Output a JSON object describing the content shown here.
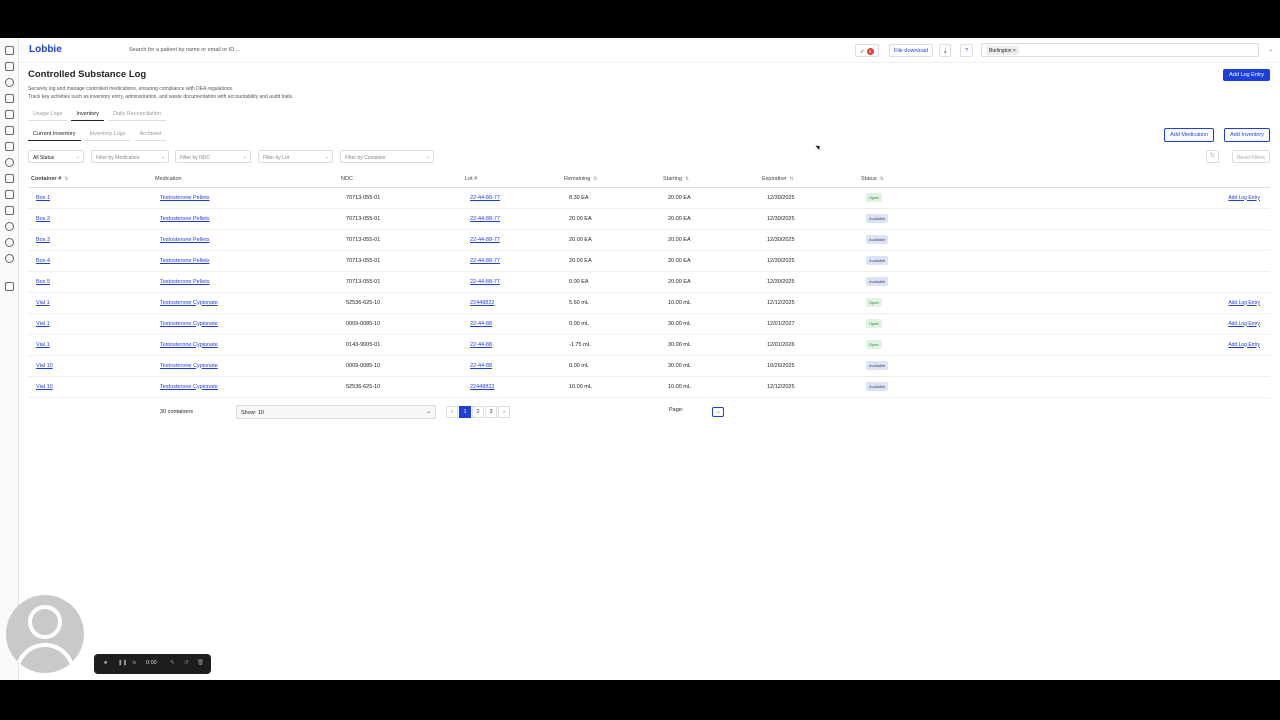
{
  "app": {
    "logo": "Lobbie"
  },
  "topbar": {
    "search_placeholder": "Search for a patient by name or email or ID ...",
    "tasks_count": "6",
    "file_download": "File download",
    "location_chip": "Burlington"
  },
  "page": {
    "title": "Controlled Substance Log",
    "desc_line1": "Securely log and manage controlled medications, ensuring compliance with DEA regulations.",
    "desc_line2": "Track key activities such as inventory entry, administration, and waste documentation with accountability and audit trails.",
    "add_log_entry": "Add Log Entry"
  },
  "tabs": [
    "Usage Logs",
    "Inventory",
    "Daily Reconciliation"
  ],
  "subtabs": [
    "Current Inventory",
    "Inventory Logs",
    "Archived"
  ],
  "buttons": {
    "add_medication": "Add Medication",
    "add_inventory": "Add Inventory",
    "reset_filters": "Reset Filters"
  },
  "filters": {
    "status": "All Status",
    "medication": "Filter by Medication",
    "ndc": "Filter by NDC",
    "lot": "Filter by Lot",
    "container": "Filter by Container"
  },
  "table": {
    "headers": [
      "Container #",
      "Medication",
      "NDC",
      "Lot #",
      "Remaining",
      "Starting",
      "Expiration",
      "Status"
    ],
    "rows": [
      {
        "container": "Box 1",
        "medication": "Testosterone Pellets",
        "ndc": "70713-055-01",
        "lot": "22-44-88-77",
        "remaining": "8.30 EA",
        "starting": "20.00 EA",
        "expiration": "12/30/2025",
        "status": "Open",
        "action": "Add Log Entry"
      },
      {
        "container": "Box 2",
        "medication": "Testosterone Pellets",
        "ndc": "70713-055-01",
        "lot": "22-44-88-77",
        "remaining": "20.00 EA",
        "starting": "20.00 EA",
        "expiration": "12/30/2025",
        "status": "Available",
        "action": ""
      },
      {
        "container": "Box 3",
        "medication": "Testosterone Pellets",
        "ndc": "70713-055-01",
        "lot": "22-44-88-77",
        "remaining": "20.00 EA",
        "starting": "20.00 EA",
        "expiration": "12/30/2025",
        "status": "Available",
        "action": ""
      },
      {
        "container": "Box 4",
        "medication": "Testosterone Pellets",
        "ndc": "70713-055-01",
        "lot": "22-44-88-77",
        "remaining": "20.00 EA",
        "starting": "20.00 EA",
        "expiration": "12/30/2025",
        "status": "Available",
        "action": ""
      },
      {
        "container": "Box 5",
        "medication": "Testosterone Pellets",
        "ndc": "70713-055-01",
        "lot": "22-44-88-77",
        "remaining": "0.00 EA",
        "starting": "20.00 EA",
        "expiration": "12/30/2025",
        "status": "Available",
        "action": ""
      },
      {
        "container": "Vial 1",
        "medication": "Testosterone Cypionate",
        "ndc": "52536-625-10",
        "lot": "22448822",
        "remaining": "5.60 mL",
        "starting": "10.00 mL",
        "expiration": "12/12/2025",
        "status": "Open",
        "action": "Add Log Entry"
      },
      {
        "container": "Vial 1",
        "medication": "Testosterone Cypionate",
        "ndc": "0009-0085-10",
        "lot": "22-44-88",
        "remaining": "0.00 mL",
        "starting": "30.00 mL",
        "expiration": "12/01/2027",
        "status": "Open",
        "action": "Add Log Entry"
      },
      {
        "container": "Vial 1",
        "medication": "Testosterone Cypionate",
        "ndc": "0143-9005-01",
        "lot": "22-44-88",
        "remaining": "-1.75 mL",
        "starting": "30.00 mL",
        "expiration": "12/01/2026",
        "status": "Open",
        "action": "Add Log Entry"
      },
      {
        "container": "Vial 10",
        "medication": "Testosterone Cypionate",
        "ndc": "0009-0085-10",
        "lot": "22-44-88",
        "remaining": "0.00 mL",
        "starting": "30.00 mL",
        "expiration": "10/26/2025",
        "status": "Available",
        "action": ""
      },
      {
        "container": "Vial 10",
        "medication": "Testosterone Cypionate",
        "ndc": "52536-625-10",
        "lot": "22448822",
        "remaining": "10.00 mL",
        "starting": "10.00 mL",
        "expiration": "12/12/2025",
        "status": "Available",
        "action": ""
      }
    ]
  },
  "pagination": {
    "count": "30 containers",
    "show": "Show: 10",
    "pages": [
      "1",
      "2",
      "3"
    ],
    "current": "1",
    "page_label": "Page:"
  },
  "recorder": {
    "time": "0:00"
  },
  "colors": {
    "accent": "#1e3fd8",
    "open": "#dff3e1",
    "available": "#dde3f3"
  }
}
